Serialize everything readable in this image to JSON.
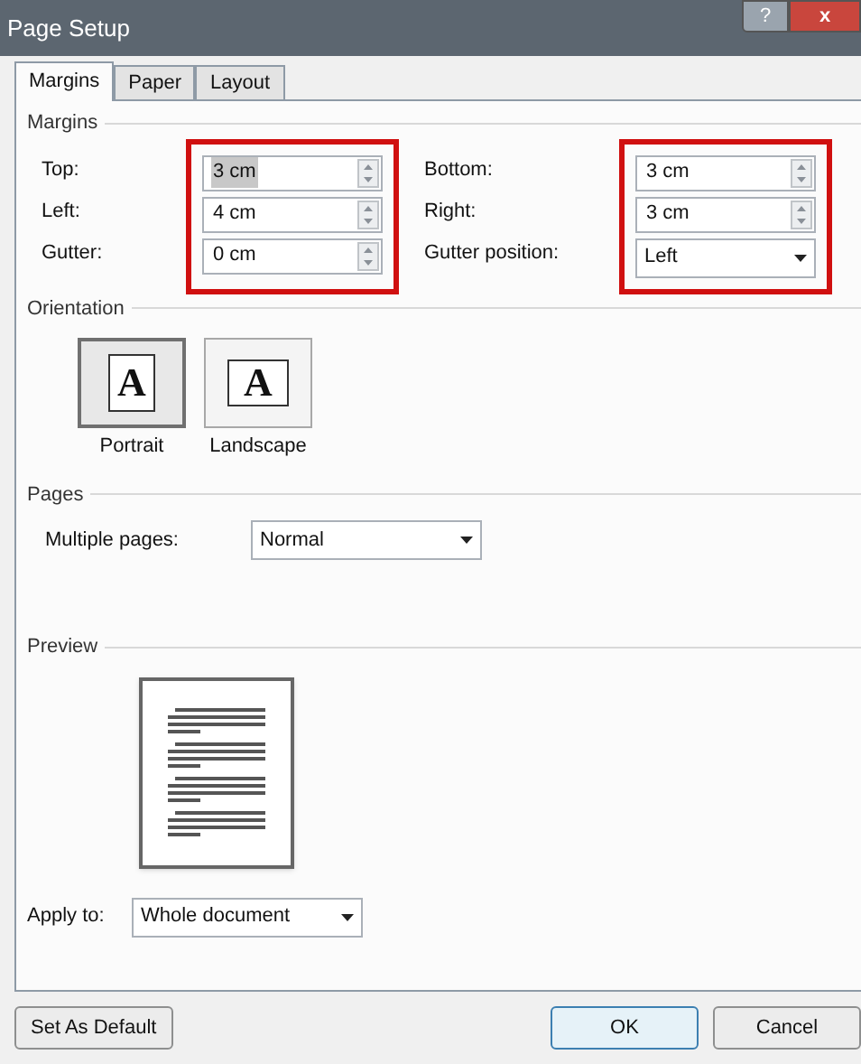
{
  "window": {
    "title": "Page Setup",
    "buttons": [
      "?",
      "x"
    ]
  },
  "tabs": [
    {
      "label": "Margins",
      "selected": true
    },
    {
      "label": "Paper",
      "selected": false
    },
    {
      "label": "Layout",
      "selected": false
    }
  ],
  "margins": {
    "heading": "Margins",
    "columns": [
      {
        "highlighted": true,
        "fields": [
          {
            "label": "Top:",
            "value": "3 cm",
            "kind": "spin",
            "selected": true
          },
          {
            "label": "Left:",
            "value": "4 cm",
            "kind": "spin",
            "selected": false
          },
          {
            "label": "Gutter:",
            "value": "0 cm",
            "kind": "spin",
            "selected": false
          }
        ]
      },
      {
        "highlighted": true,
        "fields": [
          {
            "label": "Bottom:",
            "value": "3 cm",
            "kind": "spin",
            "selected": false
          },
          {
            "label": "Right:",
            "value": "3 cm",
            "kind": "spin",
            "selected": false
          },
          {
            "label": "Gutter position:",
            "value": "Left",
            "kind": "dropdown",
            "selected": false
          }
        ]
      }
    ]
  },
  "orientation": {
    "heading": "Orientation",
    "options": [
      {
        "label": "Portrait",
        "glyph": "A",
        "selected": true
      },
      {
        "label": "Landscape",
        "glyph": "A",
        "selected": false
      }
    ]
  },
  "pages": {
    "heading": "Pages",
    "label": "Multiple pages:",
    "value": "Normal"
  },
  "preview": {
    "heading": "Preview"
  },
  "apply_to": {
    "label": "Apply to:",
    "value": "Whole document"
  },
  "buttons": [
    {
      "label": "Set As Default",
      "kind": "secondary"
    },
    {
      "label": "OK",
      "kind": "default"
    },
    {
      "label": "Cancel",
      "kind": "secondary"
    }
  ]
}
